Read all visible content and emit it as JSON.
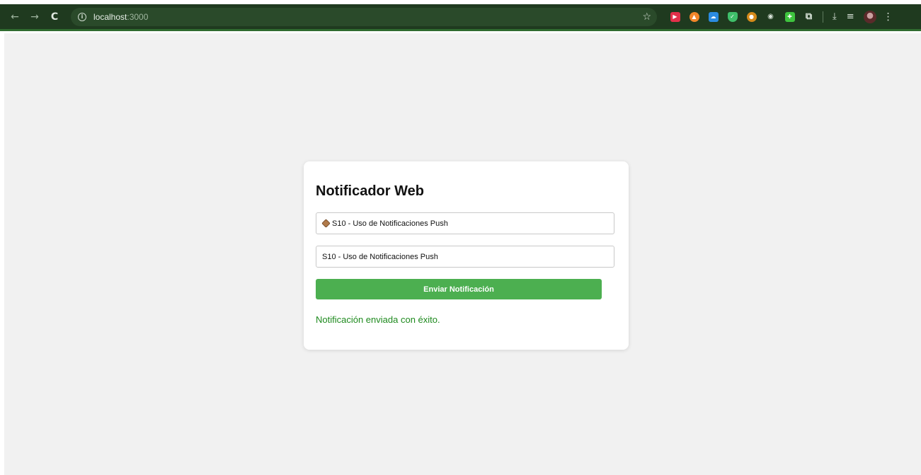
{
  "browser": {
    "url_host": "localhost",
    "url_port": ":3000",
    "nav": {
      "back": "←",
      "forward": "→",
      "reload": "C"
    },
    "extensions": [
      "red-extension-icon",
      "orange-extension-icon",
      "cloud-extension-icon",
      "shield-extension-icon",
      "amber-extension-icon",
      "eye-extension-icon",
      "lime-extension-icon",
      "puzzle-extensions-icon"
    ],
    "accent": "#1f3a1f"
  },
  "card": {
    "title": "Notificador Web",
    "title_input_value": "S10 - Uso de Notificaciones Push",
    "body_input_value": "S10 - Uso de Notificaciones Push",
    "send_label": "Enviar Notificación",
    "status_text": "Notificación enviada con éxito.",
    "button_color": "#4caf50",
    "status_color": "#1e8a1e"
  }
}
